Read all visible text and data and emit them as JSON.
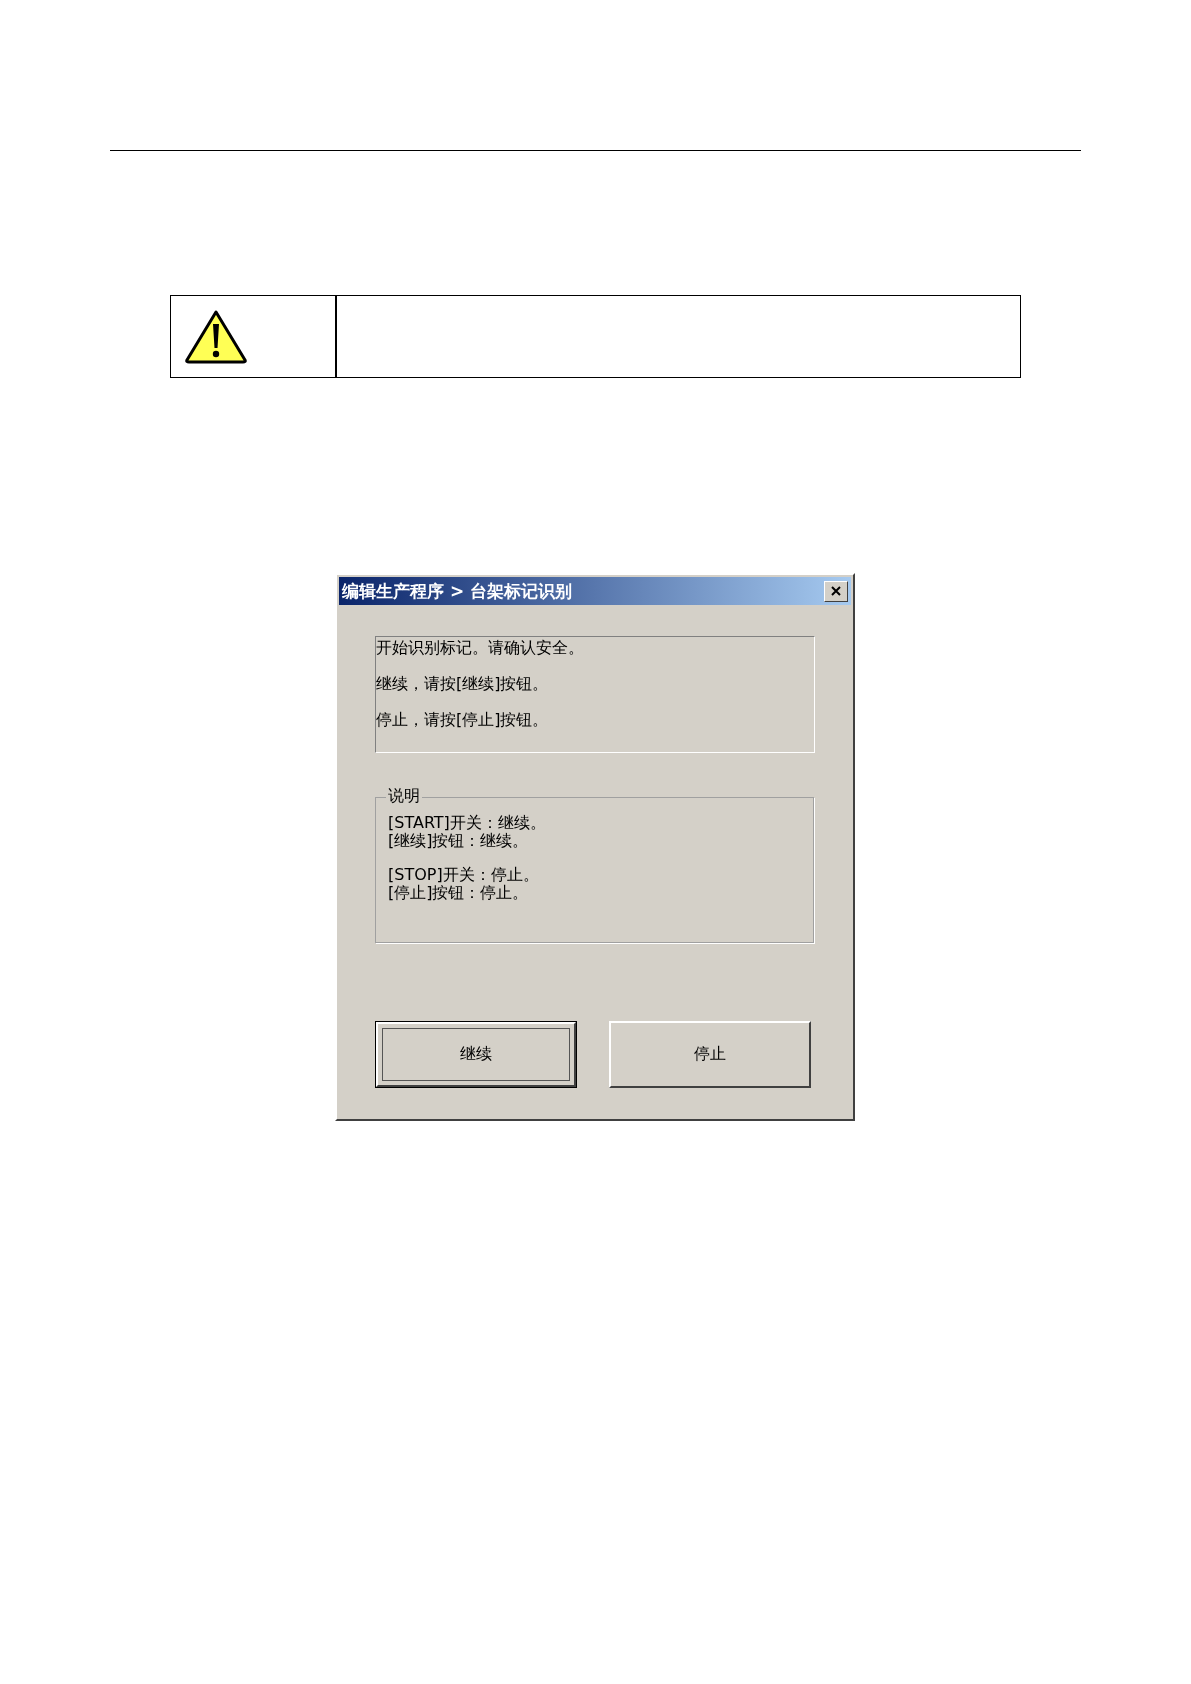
{
  "dialog": {
    "title": "编辑生产程序 > 台架标记识别",
    "message_lines": [
      "开始识别标记。请确认安全。",
      "继续，请按[继续]按钮。",
      "停止，请按[停止]按钮。"
    ],
    "group": {
      "legend": "说明",
      "paragraphs": [
        [
          "[START]开关：继续。",
          "[继续]按钮：继续。"
        ],
        [
          "[STOP]开关：停止。",
          "[停止]按钮：停止。"
        ]
      ]
    },
    "buttons": [
      {
        "label": "继续",
        "default": true
      },
      {
        "label": "停止",
        "default": false
      }
    ]
  }
}
